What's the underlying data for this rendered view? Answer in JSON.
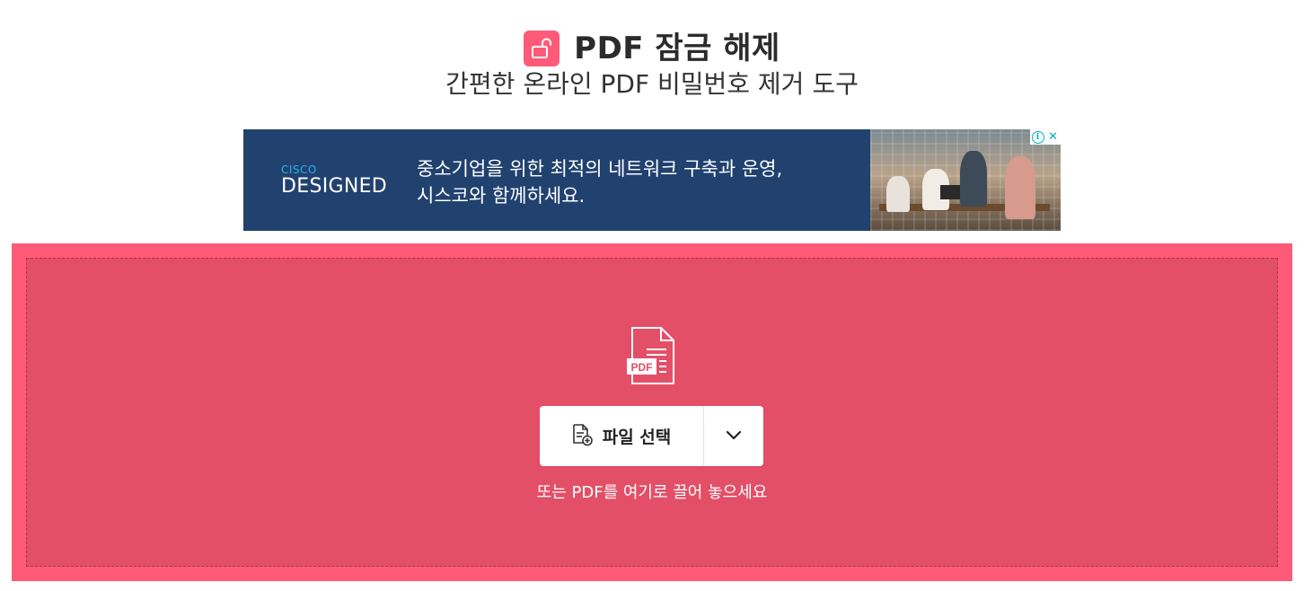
{
  "header": {
    "title": "PDF 잠금 해제",
    "subtitle": "간편한 온라인 PDF 비밀번호 제거 도구",
    "icon": "unlock-icon",
    "accent_color": "#ff5a77"
  },
  "ad": {
    "brand_small": "CISCO",
    "brand_large": "DESIGNED",
    "line1": "중소기업을 위한 최적의 네트워크 구축과 운영,",
    "line2": "시스코와 함께하세요.",
    "info_icon_text": "i",
    "close_icon_text": "✕",
    "background_color": "#21416f"
  },
  "dropzone": {
    "background_color": "#e44f68",
    "file_icon_badge": "PDF",
    "select_button_label": "파일 선택",
    "hint": "또는 PDF를 여기로 끌어 놓으세요"
  }
}
